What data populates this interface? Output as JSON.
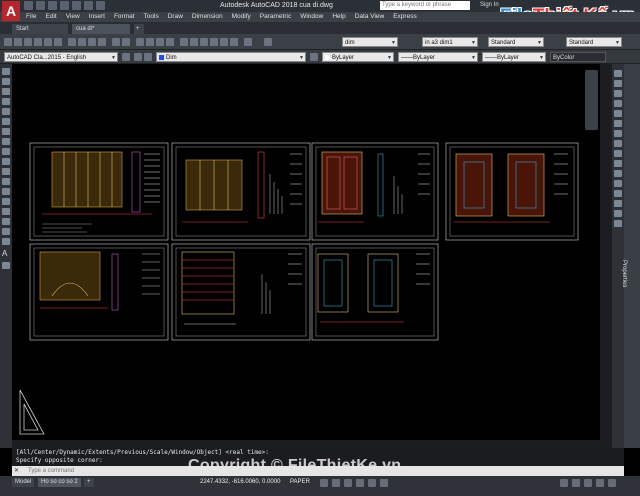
{
  "titlebar": {
    "app_logo": "A",
    "title": "Autodesk AutoCAD 2018    cua di.dwg",
    "search_placeholder": "Type a keyword or phrase",
    "sign_in": "Sign In",
    "brand_part1": "File",
    "brand_part2": "Thiết Kế",
    "brand_part3": ".vn"
  },
  "menu": [
    "File",
    "Edit",
    "View",
    "Insert",
    "Format",
    "Tools",
    "Draw",
    "Dimension",
    "Modify",
    "Parametric",
    "Window",
    "Help",
    "Data View",
    "Express"
  ],
  "tabs": {
    "start": "Start",
    "doc": "cua di*"
  },
  "toolbar": {
    "dimstyle": "dim",
    "layout_scale": "in a3 dim1",
    "textstyle": "Standard",
    "tablestyle": "Standard",
    "workspace": "AutoCAD Cla...2015 - English",
    "layer": "Dim",
    "color": "ByLayer",
    "linetype": "ByLayer",
    "lineweight": "ByLayer",
    "plotstyle": "ByColor"
  },
  "command": {
    "history1": "[All/Center/Dynamic/Extents/Previous/Scale/Window/Object] <real time>:",
    "history2": "Specify opposite corner:",
    "placeholder": "Type a command"
  },
  "status": {
    "model_tab": "Model",
    "layout_tab": "Ho so co so 2",
    "add": "+",
    "coords": "2247.4332, -616.0060, 0.0000",
    "space": "PAPER"
  },
  "properties_label": "Properties",
  "watermark": "Copyright © FileThietKe.vn",
  "colors": {
    "accent": "#b8262b",
    "brand_blue": "#2c8fd6",
    "brand_red": "#e23b2d",
    "canvas": "#000000"
  }
}
